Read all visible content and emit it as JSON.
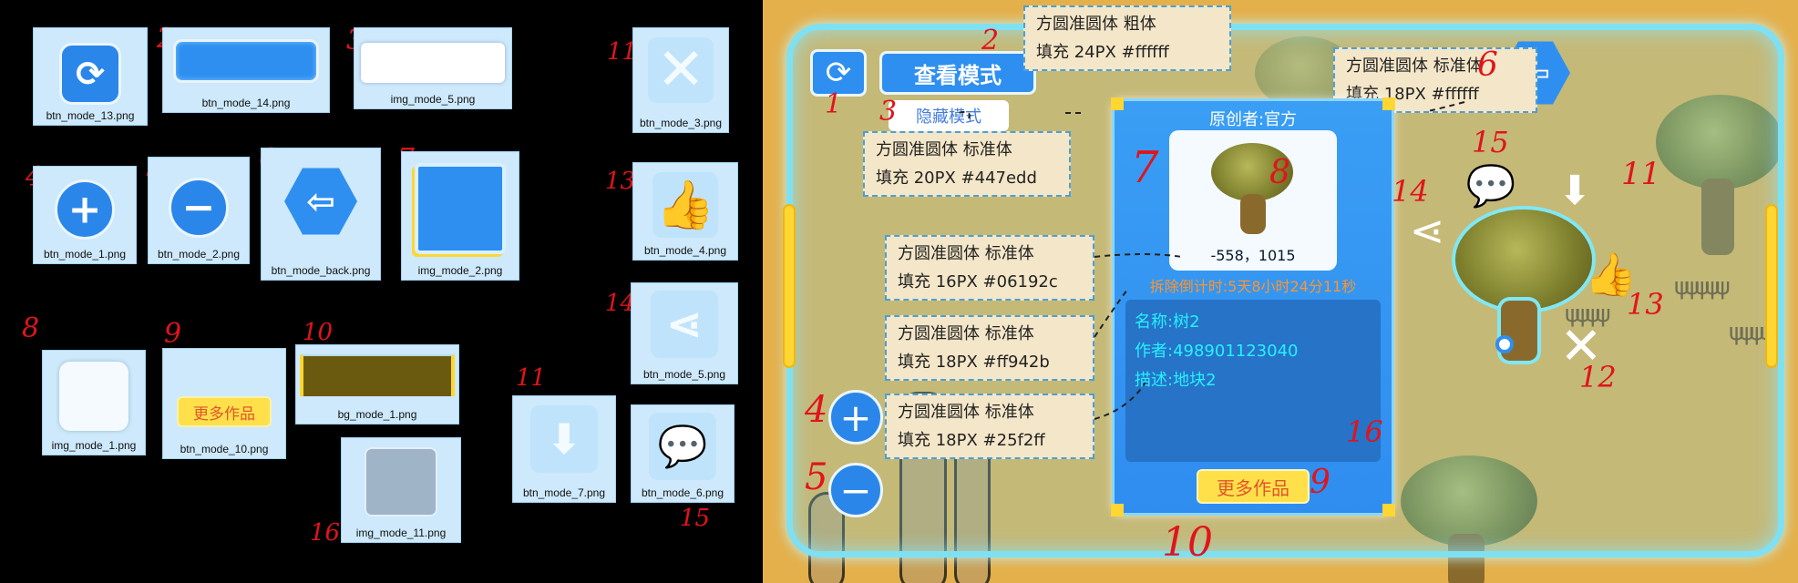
{
  "assets": [
    {
      "num": "1",
      "file": "btn_mode_13.png",
      "icon": "refresh-icon"
    },
    {
      "num": "2",
      "file": "btn_mode_14.png",
      "icon": "blue-bar"
    },
    {
      "num": "3",
      "file": "img_mode_5.png",
      "icon": "white-bar"
    },
    {
      "num": "4",
      "file": "btn_mode_1.png",
      "icon": "plus-icon"
    },
    {
      "num": "5",
      "file": "btn_mode_2.png",
      "icon": "minus-icon"
    },
    {
      "num": "6",
      "file": "btn_mode_back.png",
      "icon": "exit-icon"
    },
    {
      "num": "7",
      "file": "img_mode_2.png",
      "icon": "blue-panel"
    },
    {
      "num": "8",
      "file": "img_mode_1.png",
      "icon": "white-tile"
    },
    {
      "num": "9",
      "file": "btn_mode_10.png",
      "icon": "more-works-button",
      "text": "更多作品"
    },
    {
      "num": "10",
      "file": "bg_mode_1.png",
      "icon": "olive-bar"
    },
    {
      "num": "11",
      "file": "btn_mode_7.png",
      "icon": "download-icon"
    },
    {
      "num": "12",
      "file": "btn_mode_3.png",
      "icon": "close-icon"
    },
    {
      "num": "13",
      "file": "btn_mode_4.png",
      "icon": "thumbs-up-icon"
    },
    {
      "num": "14",
      "file": "btn_mode_5.png",
      "icon": "share-icon"
    },
    {
      "num": "15",
      "file": "btn_mode_6.png",
      "icon": "chat-icon"
    },
    {
      "num": "16",
      "file": "img_mode_11.png",
      "icon": "gray-tile"
    }
  ],
  "scene": {
    "view_mode_label": "查看模式",
    "hide_mode_label": "隐藏模式",
    "creator_label": "原创者:官方",
    "coords": "-558，1015",
    "countdown": "拆除倒计时:5天8小时24分11秒",
    "name_line": "名称:树2",
    "author_line": "作者:498901123040",
    "desc_line": "描述:地块2",
    "more_works_label": "更多作品",
    "notes": [
      {
        "line1": "方圆准圆体  粗体",
        "line2": "填充 24PX  #ffffff"
      },
      {
        "line1": "方圆准圆体  标准体",
        "line2": "填充 18PX  #ffffff"
      },
      {
        "line1": "方圆准圆体  标准体",
        "line2": "填充 20PX  #447edd"
      },
      {
        "line1": "方圆准圆体  标准体",
        "line2": "填充 16PX  #06192c"
      },
      {
        "line1": "方圆准圆体  标准体",
        "line2": "填充 18PX  #ff942b"
      },
      {
        "line1": "方圆准圆体  标准体",
        "line2": "填充 18PX  #25f2ff"
      }
    ],
    "markers": [
      "1",
      "2",
      "3",
      "4",
      "5",
      "6",
      "7",
      "8",
      "9",
      "10",
      "11",
      "12",
      "13",
      "14",
      "15",
      "16"
    ]
  },
  "colors": {
    "accent_blue": "#2f8ff0",
    "frame_cyan": "#7fe0f2",
    "more_works_yellow": "#ffe04a",
    "countdown_orange": "#ff942b",
    "info_cyan": "#25f2ff",
    "hide_mode_blue": "#447edd",
    "coords_dark": "#06192c",
    "marker_red": "#e0141c"
  }
}
